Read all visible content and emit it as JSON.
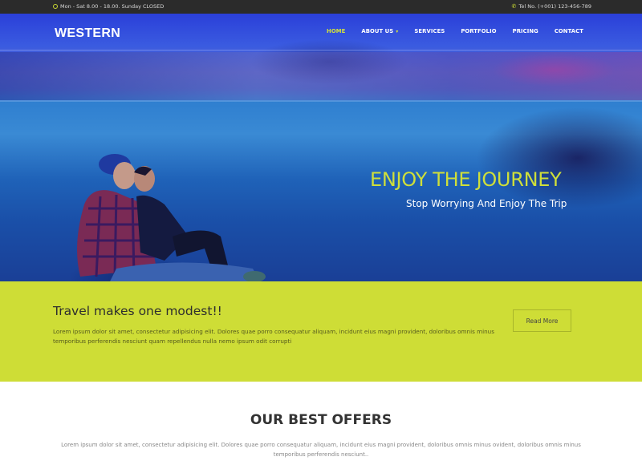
{
  "topbar": {
    "hours": "Mon - Sat 8.00 - 18.00. Sunday CLOSED",
    "hours_icon": "clock-icon",
    "phone": "Tel No. (+001) 123-456-789",
    "phone_icon": "phone-icon"
  },
  "header": {
    "logo": "WESTERN",
    "nav": [
      {
        "label": "HOME",
        "active": true
      },
      {
        "label": "ABOUT US",
        "has_dropdown": true
      },
      {
        "label": "SERVICES"
      },
      {
        "label": "PORTFOLIO"
      },
      {
        "label": "PRICING"
      },
      {
        "label": "CONTACT"
      }
    ]
  },
  "hero": {
    "title": "ENJOY THE JOURNEY",
    "subtitle": "Stop Worrying And Enjoy The Trip"
  },
  "callout": {
    "heading": "Travel makes one modest!!",
    "text": "Lorem ipsum dolor sit amet, consectetur adipisicing elit. Dolores quae porro consequatur aliquam, incidunt eius magni provident, doloribus omnis minus temporibus perferendis nesciunt quam repellendus nulla nemo ipsum odit corrupti",
    "button": "Read More"
  },
  "offers": {
    "title": "OUR BEST OFFERS",
    "text": "Lorem ipsum dolor sit amet, consectetur adipisicing elit. Dolores quae porro consequatur aliquam, incidunt eius magni provident, doloribus omnis minus ovident, doloribus omnis minus temporibus perferendis nesciunt.."
  },
  "colors": {
    "accent": "#cedd36",
    "topbar": "#2b2b2b",
    "hero_title": "#cfdf3a"
  }
}
